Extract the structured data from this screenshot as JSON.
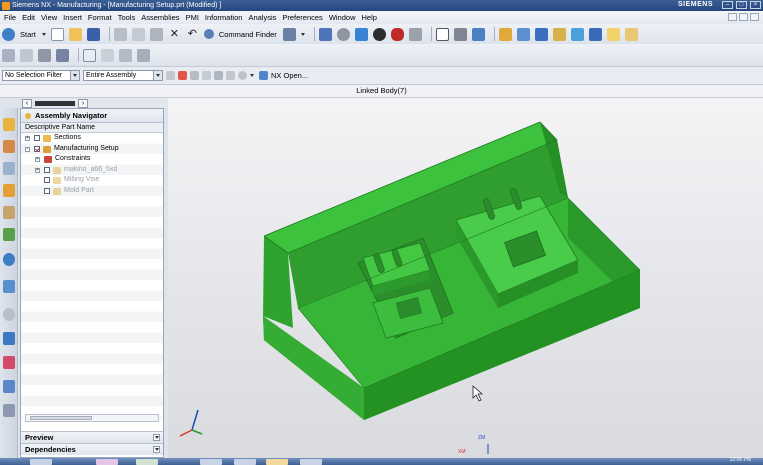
{
  "window": {
    "title": "Siemens NX - Manufacturing - [Manufacturing Setup.prt (Modified) ]",
    "brand": "SIEMENS"
  },
  "menu": [
    "File",
    "Edit",
    "View",
    "Insert",
    "Format",
    "Tools",
    "Assemblies",
    "PMI",
    "Information",
    "Analysis",
    "Preferences",
    "Window",
    "Help"
  ],
  "toolbar": {
    "start_label": "Start",
    "command_finder_label": "Command Finder"
  },
  "selection_bar": {
    "filter_value": "No Selection Filter",
    "scope_value": "Entire Assembly",
    "nx_open_label": "NX Open..."
  },
  "status": {
    "message": "Linked Body(7)"
  },
  "navigator": {
    "title": "Assembly Navigator",
    "column_header": "Descriptive Part Name",
    "tree": [
      {
        "label": "Sections",
        "level": 0,
        "expander": "+",
        "checked": false,
        "icon": "folder",
        "dim": false
      },
      {
        "label": "Manufacturing Setup",
        "level": 0,
        "expander": "-",
        "checked": true,
        "icon": "assembly",
        "dim": false
      },
      {
        "label": "Constraints",
        "level": 1,
        "expander": "+",
        "checked": null,
        "icon": "constraints",
        "dim": false
      },
      {
        "label": "makino_a66_5xd",
        "level": 1,
        "expander": "+",
        "checked": false,
        "icon": "part",
        "dim": true
      },
      {
        "label": "Milling Vise",
        "level": 1,
        "expander": "",
        "checked": false,
        "icon": "part",
        "dim": true
      },
      {
        "label": "Mold Part",
        "level": 1,
        "expander": "",
        "checked": false,
        "icon": "part",
        "dim": true
      }
    ],
    "sections": [
      "Preview",
      "Dependencies"
    ]
  },
  "viewport": {
    "triad_labels": [
      "ZM",
      "XM"
    ],
    "model_color": "#2c9a2c"
  },
  "taskbar": {
    "clock": "12:06 PM"
  }
}
